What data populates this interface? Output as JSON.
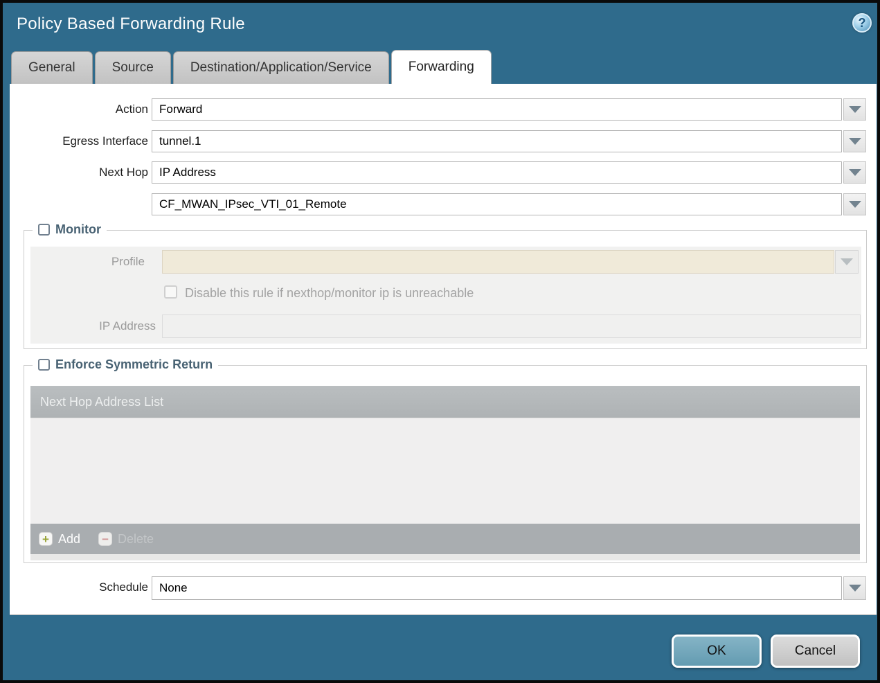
{
  "dialog": {
    "title": "Policy Based Forwarding Rule",
    "help_glyph": "?"
  },
  "tabs": [
    {
      "label": "General",
      "active": false
    },
    {
      "label": "Source",
      "active": false
    },
    {
      "label": "Destination/Application/Service",
      "active": false
    },
    {
      "label": "Forwarding",
      "active": true
    }
  ],
  "form": {
    "action": {
      "label": "Action",
      "value": "Forward"
    },
    "egress_interface": {
      "label": "Egress Interface",
      "value": "tunnel.1"
    },
    "next_hop": {
      "label": "Next Hop",
      "value": "IP Address"
    },
    "next_hop_address": {
      "value": "CF_MWAN_IPsec_VTI_01_Remote"
    },
    "schedule": {
      "label": "Schedule",
      "value": "None"
    }
  },
  "monitor": {
    "legend": "Monitor",
    "checked": false,
    "profile": {
      "label": "Profile",
      "value": ""
    },
    "disable_rule_label": "Disable this rule if nexthop/monitor ip is unreachable",
    "disable_rule_checked": false,
    "ip_address": {
      "label": "IP Address",
      "value": ""
    }
  },
  "symmetric_return": {
    "legend": "Enforce Symmetric Return",
    "checked": false,
    "table_header": "Next Hop Address List",
    "rows": [],
    "add_label": "Add",
    "add_glyph": "+",
    "delete_label": "Delete",
    "delete_glyph": "−",
    "delete_enabled": false
  },
  "footer_buttons": {
    "ok": "OK",
    "cancel": "Cancel"
  },
  "colors": {
    "dialog_background": "#2f6b8c",
    "ok_button": "#74a7bb",
    "profile_field": "#f0ead9",
    "table_header": "#b4b8ba",
    "add_plus": "#97a335",
    "delete_minus": "#cf9393"
  }
}
